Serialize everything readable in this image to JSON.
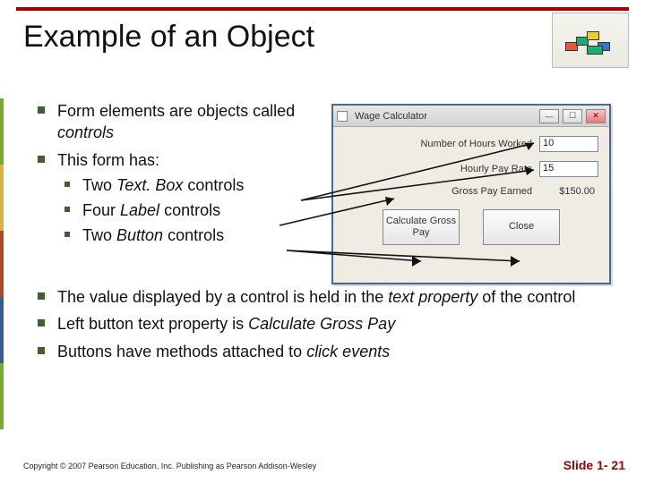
{
  "title": "Example of an Object",
  "bullets_top": [
    {
      "pre": "Form elements are objects called ",
      "ital": "controls",
      "post": ""
    },
    {
      "pre": "This form has:",
      "ital": "",
      "post": ""
    }
  ],
  "sub_bullets": [
    {
      "pre": "Two ",
      "ital": "Text. Box",
      "post": " controls"
    },
    {
      "pre": "Four ",
      "ital": "Label",
      "post": " controls"
    },
    {
      "pre": "Two ",
      "ital": "Button",
      "post": " controls"
    }
  ],
  "bullets_bottom": [
    {
      "pre": "The value displayed by a control is held in the ",
      "ital": "text property",
      "post": " of the control"
    },
    {
      "pre": "Left button text property is ",
      "ital": "Calculate Gross Pay",
      "post": ""
    },
    {
      "pre": "Buttons have methods attached to ",
      "ital": "click events",
      "post": ""
    }
  ],
  "window": {
    "title": "Wage Calculator",
    "labels": {
      "hours": "Number of Hours Worked",
      "rate": "Hourly Pay Rate",
      "gross": "Gross Pay Earned"
    },
    "values": {
      "hours": "10",
      "rate": "15",
      "gross": "$150.00"
    },
    "buttons": {
      "calc": "Calculate Gross Pay",
      "close": "Close"
    }
  },
  "footer": "Copyright © 2007 Pearson Education, Inc. Publishing as Pearson Addison-Wesley",
  "slide_number": "Slide 1- 21"
}
